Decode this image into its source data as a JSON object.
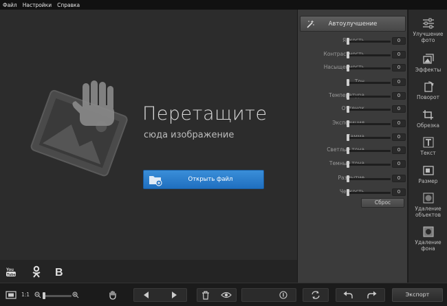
{
  "menu": {
    "items": [
      "Файл",
      "Настройки",
      "Справка"
    ]
  },
  "canvas": {
    "title": "Перетащите",
    "subtitle": "сюда изображение",
    "open_button_label": "Открыть файл"
  },
  "social": {
    "icons": [
      "youtube-icon",
      "odnoklassniki-icon",
      "vkontakte-icon"
    ]
  },
  "panel": {
    "auto_label": "Автоулучшение",
    "groups": [
      [
        {
          "label": "Яркость",
          "value": "0"
        },
        {
          "label": "Контрастность",
          "value": "0"
        },
        {
          "label": "Насыщенность",
          "value": "0"
        }
      ],
      [
        {
          "label": "Тон",
          "value": "0"
        },
        {
          "label": "Температура",
          "value": "0"
        },
        {
          "label": "Оттенок",
          "value": "0"
        }
      ],
      [
        {
          "label": "Экспозиция",
          "value": "0"
        },
        {
          "label": "Гамма",
          "value": "0"
        },
        {
          "label": "Светлые тона",
          "value": "0"
        },
        {
          "label": "Темные тона",
          "value": "0"
        }
      ],
      [
        {
          "label": "Размытие",
          "value": "0"
        },
        {
          "label": "Четкость",
          "value": "0"
        }
      ]
    ],
    "reset_label": "Сброс"
  },
  "tools": [
    {
      "label": "Улучшение фото",
      "icon": "sliders-icon"
    },
    {
      "label": "Эффекты",
      "icon": "effects-icon"
    },
    {
      "label": "Поворот",
      "icon": "rotate-icon"
    },
    {
      "label": "Обрезка",
      "icon": "crop-icon"
    },
    {
      "label": "Текст",
      "icon": "text-icon"
    },
    {
      "label": "Размер",
      "icon": "resize-icon"
    },
    {
      "label": "Удаление объектов",
      "icon": "remove-objects-icon"
    },
    {
      "label": "Удаление фона",
      "icon": "remove-background-icon"
    }
  ],
  "bottom": {
    "zoom_label": "1:1",
    "zoom_level": 0.05,
    "export_label": "Экспорт"
  },
  "colors": {
    "accent": "#2a80d0",
    "panel_bg": "#3b3b3b",
    "canvas_bg": "#2c2c2c"
  }
}
